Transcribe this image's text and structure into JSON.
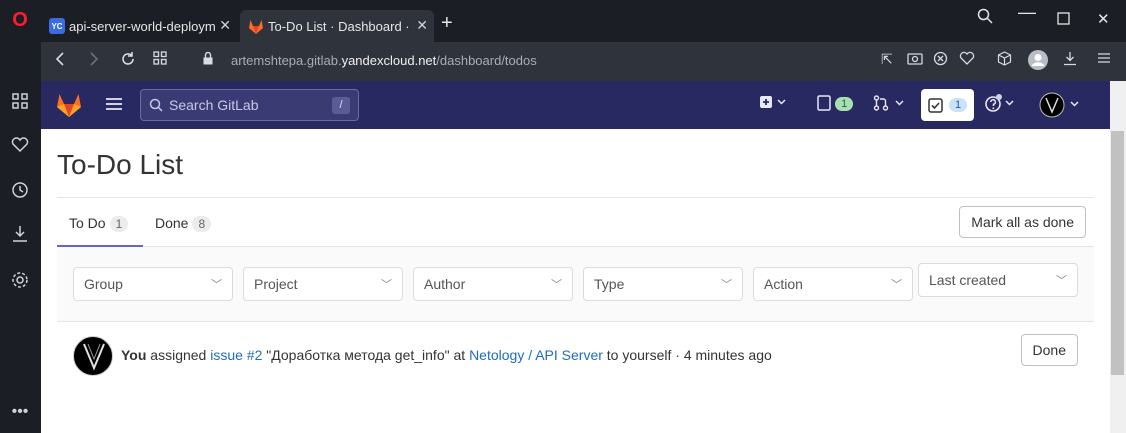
{
  "browser": {
    "tabs": [
      {
        "favicon": "YC",
        "title": "api-server-world-deployme"
      },
      {
        "favicon": "gitlab",
        "title": "To-Do List · Dashboard · Gi"
      }
    ],
    "url": {
      "prefix": "artemshtepa.gitlab.",
      "host": "yandexcloud.net",
      "path": "/dashboard/todos"
    }
  },
  "gitlab_header": {
    "search_placeholder": "Search GitLab",
    "search_shortcut": "/",
    "issues_count": "1",
    "todos_count": "1"
  },
  "page": {
    "title": "To-Do List",
    "tabs": [
      {
        "label": "To Do",
        "count": "1"
      },
      {
        "label": "Done",
        "count": "8"
      }
    ],
    "mark_all_label": "Mark all as done",
    "filters": [
      "Group",
      "Project",
      "Author",
      "Type",
      "Action"
    ],
    "sort_label": "Last created"
  },
  "todo": {
    "actor": "You",
    "verb": "assigned",
    "issue_link": "issue #2",
    "issue_title": "\"Доработка метода get_info\"",
    "at": "at",
    "project_link": "Netology / API Server",
    "target": "to yourself · 4 minutes ago",
    "done_label": "Done"
  },
  "colors": {
    "gitlab_nav": "#292961",
    "link": "#1f6bbf",
    "accent_tab": "#6666c4"
  }
}
